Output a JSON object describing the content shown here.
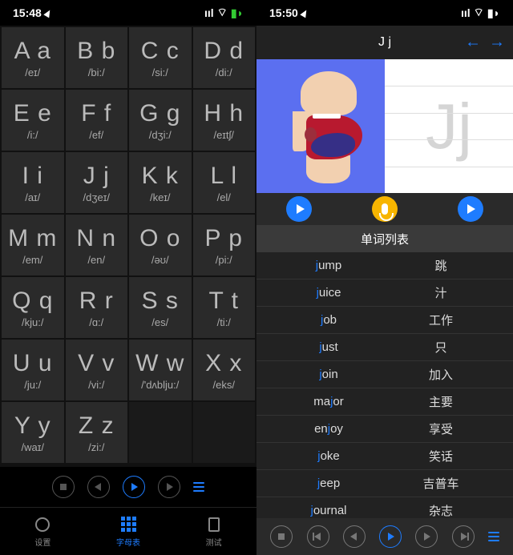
{
  "left": {
    "status": {
      "time": "15:48",
      "signal": "••ıl",
      "wifi": "",
      "battery": ""
    },
    "letters": [
      {
        "u": "A",
        "l": "a",
        "ipa": "/eɪ/"
      },
      {
        "u": "B",
        "l": "b",
        "ipa": "/bi:/"
      },
      {
        "u": "C",
        "l": "c",
        "ipa": "/si:/"
      },
      {
        "u": "D",
        "l": "d",
        "ipa": "/di:/"
      },
      {
        "u": "E",
        "l": "e",
        "ipa": "/i:/"
      },
      {
        "u": "F",
        "l": "f",
        "ipa": "/ef/"
      },
      {
        "u": "G",
        "l": "g",
        "ipa": "/dʒi:/"
      },
      {
        "u": "H",
        "l": "h",
        "ipa": "/eɪtʃ/"
      },
      {
        "u": "I",
        "l": "i",
        "ipa": "/aɪ/"
      },
      {
        "u": "J",
        "l": "j",
        "ipa": "/dʒeɪ/"
      },
      {
        "u": "K",
        "l": "k",
        "ipa": "/keɪ/"
      },
      {
        "u": "L",
        "l": "l",
        "ipa": "/el/"
      },
      {
        "u": "M",
        "l": "m",
        "ipa": "/em/"
      },
      {
        "u": "N",
        "l": "n",
        "ipa": "/en/"
      },
      {
        "u": "O",
        "l": "o",
        "ipa": "/əʊ/"
      },
      {
        "u": "P",
        "l": "p",
        "ipa": "/pi:/"
      },
      {
        "u": "Q",
        "l": "q",
        "ipa": "/kju:/"
      },
      {
        "u": "R",
        "l": "r",
        "ipa": "/ɑ:/"
      },
      {
        "u": "S",
        "l": "s",
        "ipa": "/es/"
      },
      {
        "u": "T",
        "l": "t",
        "ipa": "/ti:/"
      },
      {
        "u": "U",
        "l": "u",
        "ipa": "/ju:/"
      },
      {
        "u": "V",
        "l": "v",
        "ipa": "/vi:/"
      },
      {
        "u": "W",
        "l": "w",
        "ipa": "/'dʌblju:/"
      },
      {
        "u": "X",
        "l": "x",
        "ipa": "/eks/"
      },
      {
        "u": "Y",
        "l": "y",
        "ipa": "/waɪ/"
      },
      {
        "u": "Z",
        "l": "z",
        "ipa": "/zi:/"
      }
    ],
    "tabs": {
      "settings": "设置",
      "alphabet": "字母表",
      "test": "测试"
    }
  },
  "right": {
    "status": {
      "time": "15:50"
    },
    "header": {
      "title": "J j"
    },
    "big_letter": "Jj",
    "word_header": "单词列表",
    "words": [
      {
        "pre": "",
        "hl": "j",
        "post": "ump",
        "zh": "跳"
      },
      {
        "pre": "",
        "hl": "j",
        "post": "uice",
        "zh": "汁"
      },
      {
        "pre": "",
        "hl": "j",
        "post": "ob",
        "zh": "工作"
      },
      {
        "pre": "",
        "hl": "j",
        "post": "ust",
        "zh": "只"
      },
      {
        "pre": "",
        "hl": "j",
        "post": "oin",
        "zh": "加入"
      },
      {
        "pre": "ma",
        "hl": "j",
        "post": "or",
        "zh": "主要"
      },
      {
        "pre": "en",
        "hl": "j",
        "post": "oy",
        "zh": "享受"
      },
      {
        "pre": "",
        "hl": "j",
        "post": "oke",
        "zh": "笑话"
      },
      {
        "pre": "",
        "hl": "j",
        "post": "eep",
        "zh": "吉普车"
      },
      {
        "pre": "",
        "hl": "j",
        "post": "ournal",
        "zh": "杂志"
      }
    ]
  }
}
